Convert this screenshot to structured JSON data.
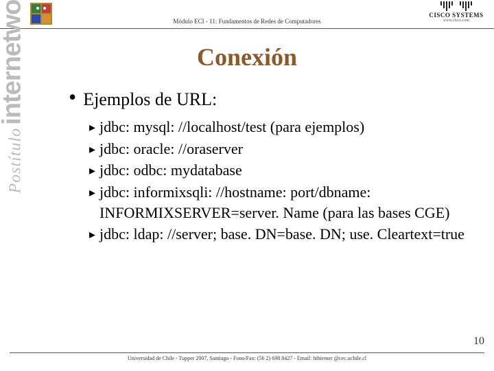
{
  "header": {
    "module": "Módulo ECI - 11: Fundamentos de Redes de Computadores",
    "cisco_name": "CISCO SYSTEMS",
    "cisco_url": "www.cisco.com"
  },
  "side": {
    "postitulo": "Postítulo",
    "internetworking": "internetworking"
  },
  "title": "Conexión",
  "main_bullet": "Ejemplos de URL:",
  "items": [
    "jdbc: mysql: //localhost/test (para ejemplos)",
    "jdbc: oracle: //oraserver",
    "jdbc: odbc: mydatabase",
    "jdbc: informixsqli: //hostname: port/dbname: INFORMIXSERVER=server. Name   (para las bases CGE)",
    "jdbc: ldap: //server; base. DN=base. DN; use. Cleartext=true"
  ],
  "page_number": "10",
  "footer": "Universidad de Chile - Tupper 2007, Santiago - Fono/Fax: (56 2) 698 8427 - Email: hthiemer @cec.uchile.cl"
}
